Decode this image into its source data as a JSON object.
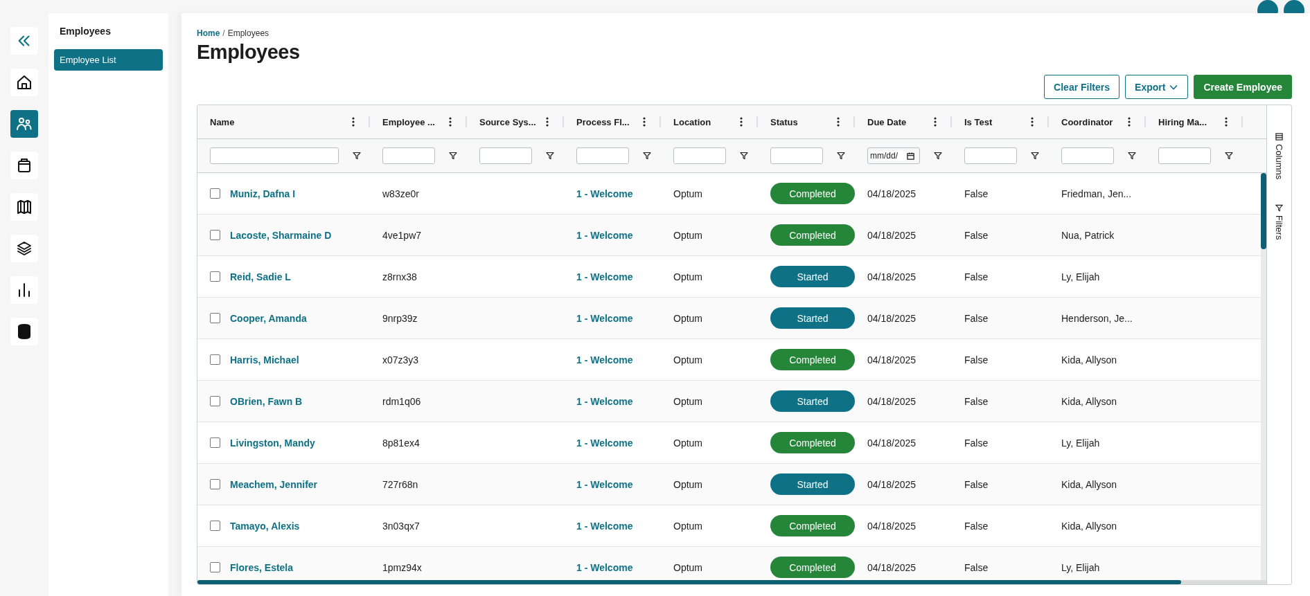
{
  "rail": {
    "items": [
      {
        "selected": false
      },
      {
        "selected": true
      },
      {
        "selected": false
      },
      {
        "selected": false
      },
      {
        "selected": false
      },
      {
        "selected": false
      },
      {
        "selected": false
      }
    ]
  },
  "sidebar": {
    "title": "Employees",
    "items": [
      {
        "label": "Employee List",
        "selected": true
      }
    ]
  },
  "breadcrumb": {
    "items": [
      "Home",
      "Employees"
    ],
    "separator": "/"
  },
  "title": "Employees",
  "actions": {
    "clear_filters": "Clear Filters",
    "export": "Export",
    "create": "Create Employee"
  },
  "table": {
    "columns": [
      {
        "label": "Name"
      },
      {
        "label": "Employee ..."
      },
      {
        "label": "Source Sys..."
      },
      {
        "label": "Process Fl..."
      },
      {
        "label": "Location"
      },
      {
        "label": "Status"
      },
      {
        "label": "Due Date",
        "placeholder": "mm/dd/"
      },
      {
        "label": "Is Test"
      },
      {
        "label": "Coordinator"
      },
      {
        "label": "Hiring Ma..."
      }
    ],
    "rows": [
      {
        "checked": false,
        "name": "Muniz, Dafna I",
        "employee_id": "w83ze0r",
        "process_flow": "1 - Welcome",
        "location": "Optum",
        "status": {
          "label": "Completed",
          "color": "#25863a"
        },
        "due_date": "04/18/2025",
        "is_test": "False",
        "coordinator": "Friedman, Jen..."
      },
      {
        "checked": false,
        "name": "Lacoste, Sharmaine D",
        "employee_id": "4ve1pw7",
        "process_flow": "1 - Welcome",
        "location": "Optum",
        "status": {
          "label": "Completed",
          "color": "#25863a"
        },
        "due_date": "04/18/2025",
        "is_test": "False",
        "coordinator": "Nua, Patrick"
      },
      {
        "checked": false,
        "name": "Reid, Sadie L",
        "employee_id": "z8rnx38",
        "process_flow": "1 - Welcome",
        "location": "Optum",
        "status": {
          "label": "Started",
          "color": "#0e7186"
        },
        "due_date": "04/18/2025",
        "is_test": "False",
        "coordinator": "Ly, Elijah"
      },
      {
        "checked": false,
        "name": "Cooper, Amanda",
        "employee_id": "9nrp39z",
        "process_flow": "1 - Welcome",
        "location": "Optum",
        "status": {
          "label": "Started",
          "color": "#0e7186"
        },
        "due_date": "04/18/2025",
        "is_test": "False",
        "coordinator": "Henderson, Je..."
      },
      {
        "checked": false,
        "name": "Harris, Michael",
        "employee_id": "x07z3y3",
        "process_flow": "1 - Welcome",
        "location": "Optum",
        "status": {
          "label": "Completed",
          "color": "#25863a"
        },
        "due_date": "04/18/2025",
        "is_test": "False",
        "coordinator": "Kida, Allyson"
      },
      {
        "checked": false,
        "name": "OBrien, Fawn B",
        "employee_id": "rdm1q06",
        "process_flow": "1 - Welcome",
        "location": "Optum",
        "status": {
          "label": "Started",
          "color": "#0e7186"
        },
        "due_date": "04/18/2025",
        "is_test": "False",
        "coordinator": "Kida, Allyson"
      },
      {
        "checked": false,
        "name": "Livingston, Mandy",
        "employee_id": "8p81ex4",
        "process_flow": "1 - Welcome",
        "location": "Optum",
        "status": {
          "label": "Completed",
          "color": "#25863a"
        },
        "due_date": "04/18/2025",
        "is_test": "False",
        "coordinator": "Ly, Elijah"
      },
      {
        "checked": false,
        "name": "Meachem, Jennifer",
        "employee_id": "727r68n",
        "process_flow": "1 - Welcome",
        "location": "Optum",
        "status": {
          "label": "Started",
          "color": "#0e7186"
        },
        "due_date": "04/18/2025",
        "is_test": "False",
        "coordinator": "Kida, Allyson"
      },
      {
        "checked": false,
        "name": "Tamayo, Alexis",
        "employee_id": "3n03qx7",
        "process_flow": "1 - Welcome",
        "location": "Optum",
        "status": {
          "label": "Completed",
          "color": "#25863a"
        },
        "due_date": "04/18/2025",
        "is_test": "False",
        "coordinator": "Kida, Allyson"
      },
      {
        "checked": false,
        "name": "Flores, Estela",
        "employee_id": "1pmz94x",
        "process_flow": "1 - Welcome",
        "location": "Optum",
        "status": {
          "label": "Completed",
          "color": "#25863a"
        },
        "due_date": "04/18/2025",
        "is_test": "False",
        "coordinator": "Ly, Elijah"
      }
    ]
  },
  "side_panel": {
    "columns": "Columns",
    "filters": "Filters"
  }
}
